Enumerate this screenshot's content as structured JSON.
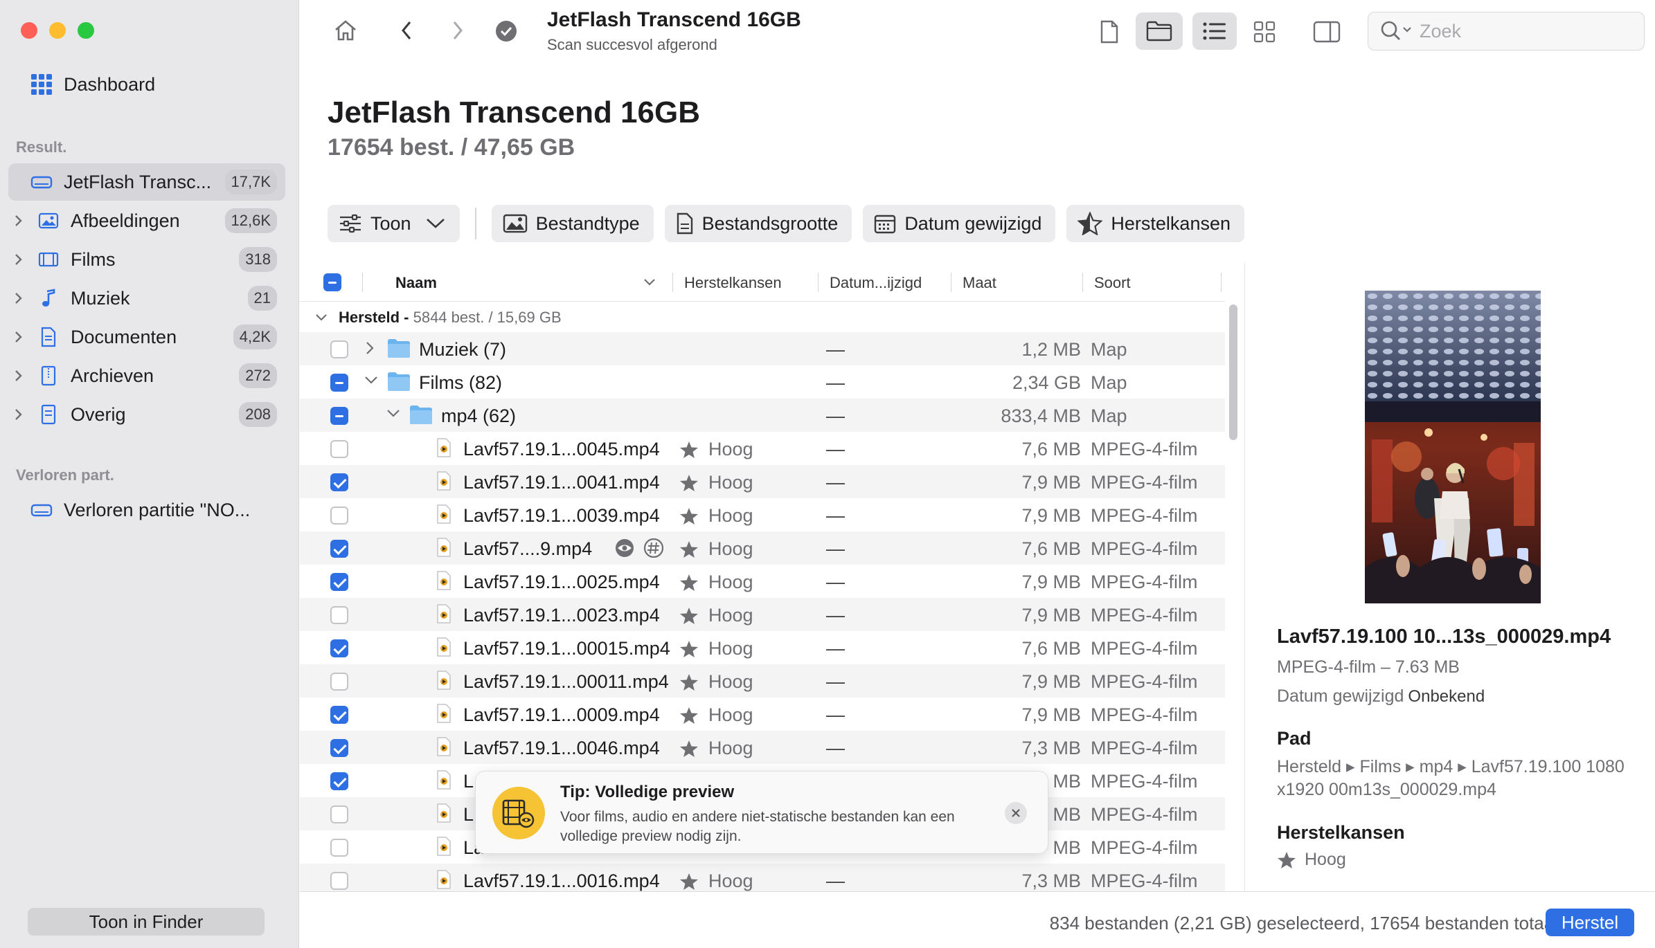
{
  "sidebar": {
    "dashboard_label": "Dashboard",
    "results_label": "Result.",
    "items": [
      {
        "label": "JetFlash Transc...",
        "count": "17,7K"
      },
      {
        "label": "Afbeeldingen",
        "count": "12,6K"
      },
      {
        "label": "Films",
        "count": "318"
      },
      {
        "label": "Muziek",
        "count": "21"
      },
      {
        "label": "Documenten",
        "count": "4,2K"
      },
      {
        "label": "Archieven",
        "count": "272"
      },
      {
        "label": "Overig",
        "count": "208"
      }
    ],
    "lost_label": "Verloren part.",
    "lost_item": "Verloren partitie \"NO...",
    "finder_button": "Toon in Finder"
  },
  "toolbar": {
    "title": "JetFlash Transcend 16GB",
    "subtitle": "Scan succesvol afgerond",
    "search_placeholder": "Zoek"
  },
  "main": {
    "title": "JetFlash Transcend 16GB",
    "subtitle": "17654 best. / 47,65 GB"
  },
  "filters": {
    "toon": "Toon",
    "bestandstype": "Bestandtype",
    "bestandsgrootte": "Bestandsgrootte",
    "datum": "Datum gewijzigd",
    "herstelkansen": "Herstelkansen"
  },
  "table": {
    "columns": {
      "name": "Naam",
      "chances": "Herstelkansen",
      "date": "Datum...ijzigd",
      "size": "Maat",
      "kind": "Soort"
    },
    "group_label": "Hersteld - ",
    "group_info": "5844 best. / 15,69 GB",
    "rows": [
      {
        "name": "Muziek (7)",
        "chance": "",
        "date": "—",
        "size": "1,2 MB",
        "kind": "Map"
      },
      {
        "name": "Films (82)",
        "chance": "",
        "date": "—",
        "size": "2,34 GB",
        "kind": "Map"
      },
      {
        "name": "mp4 (62)",
        "chance": "",
        "date": "—",
        "size": "833,4 MB",
        "kind": "Map"
      },
      {
        "name": "Lavf57.19.1...0045.mp4",
        "chance": "Hoog",
        "date": "—",
        "size": "7,6 MB",
        "kind": "MPEG-4-film"
      },
      {
        "name": "Lavf57.19.1...0041.mp4",
        "chance": "Hoog",
        "date": "—",
        "size": "7,9 MB",
        "kind": "MPEG-4-film"
      },
      {
        "name": "Lavf57.19.1...0039.mp4",
        "chance": "Hoog",
        "date": "—",
        "size": "7,9 MB",
        "kind": "MPEG-4-film"
      },
      {
        "name": "Lavf57....9.mp4",
        "chance": "Hoog",
        "date": "—",
        "size": "7,6 MB",
        "kind": "MPEG-4-film"
      },
      {
        "name": "Lavf57.19.1...0025.mp4",
        "chance": "Hoog",
        "date": "—",
        "size": "7,9 MB",
        "kind": "MPEG-4-film"
      },
      {
        "name": "Lavf57.19.1...0023.mp4",
        "chance": "Hoog",
        "date": "—",
        "size": "7,9 MB",
        "kind": "MPEG-4-film"
      },
      {
        "name": "Lavf57.19.1...00015.mp4",
        "chance": "Hoog",
        "date": "—",
        "size": "7,6 MB",
        "kind": "MPEG-4-film"
      },
      {
        "name": "Lavf57.19.1...00011.mp4",
        "chance": "Hoog",
        "date": "—",
        "size": "7,9 MB",
        "kind": "MPEG-4-film"
      },
      {
        "name": "Lavf57.19.1...0009.mp4",
        "chance": "Hoog",
        "date": "—",
        "size": "7,9 MB",
        "kind": "MPEG-4-film"
      },
      {
        "name": "Lavf57.19.1...0046.mp4",
        "chance": "Hoog",
        "date": "—",
        "size": "7,3 MB",
        "kind": "MPEG-4-film"
      },
      {
        "name": "L",
        "chance": "",
        "date": "",
        "size": "MB",
        "kind": "MPEG-4-film"
      },
      {
        "name": "L",
        "chance": "",
        "date": "",
        "size": "MB",
        "kind": "MPEG-4-film"
      },
      {
        "name": "La",
        "chance": "",
        "date": "",
        "size": "MB",
        "kind": "MPEG-4-film"
      },
      {
        "name": "Lavf57.19.1...0016.mp4",
        "chance": "Hoog",
        "date": "—",
        "size": "7,3 MB",
        "kind": "MPEG-4-film"
      }
    ]
  },
  "tip": {
    "title": "Tip: Volledige preview",
    "text": "Voor films, audio en andere niet-statische bestanden kan een volledige preview nodig zijn."
  },
  "preview": {
    "name": "Lavf57.19.100 10...13s_000029.mp4",
    "meta": "MPEG-4-film – 7.63 MB",
    "date_label": "Datum gewijzigd",
    "date_value": "Onbekend",
    "path_heading": "Pad",
    "path": "Hersteld ▸ Films ▸ mp4 ▸ Lavf57.19.100 1080 x1920 00m13s_000029.mp4",
    "chance_heading": "Herstelkansen",
    "chance": "Hoog"
  },
  "bottom": {
    "status": "834 bestanden (2,21 GB) geselecteerd, 17654 bestanden totaal",
    "recover_button": "Herstel"
  },
  "colors": {
    "accent": "#2f6fe4",
    "tip": "#f5c333",
    "sidebar": "#e8e8ea"
  }
}
